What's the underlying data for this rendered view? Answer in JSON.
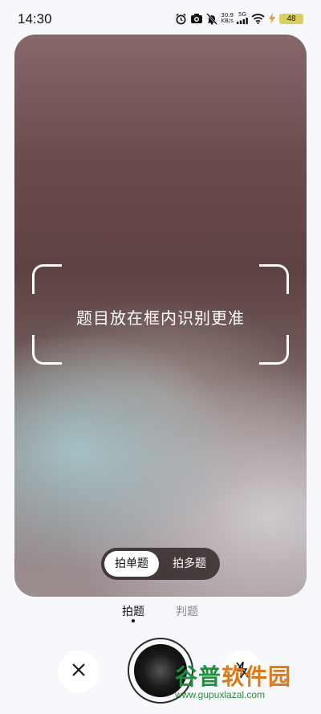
{
  "status_bar": {
    "time": "14:30",
    "network_speed_value": "30.9",
    "network_speed_unit": "KB/s",
    "network_type": "5G",
    "battery_level": "48",
    "icons": [
      "alarm-icon",
      "camera-icon",
      "mute-icon",
      "signal-icon",
      "wifi-icon",
      "charging-icon",
      "battery-icon"
    ]
  },
  "camera": {
    "hint": "题目放在框内识别更准"
  },
  "mode_toggle": {
    "single": "拍单题",
    "multi": "拍多题",
    "selected": "single"
  },
  "bottom_tabs": {
    "items": [
      "拍题",
      "判题"
    ],
    "active": 0
  },
  "controls": {
    "close_icon": "close-icon",
    "shutter_icon": "shutter-icon",
    "flash_icon": "flash-off-icon"
  },
  "watermark": {
    "brand_part1": "谷普",
    "brand_part2": "软件园",
    "url": "www.gupuxlazal.com"
  }
}
